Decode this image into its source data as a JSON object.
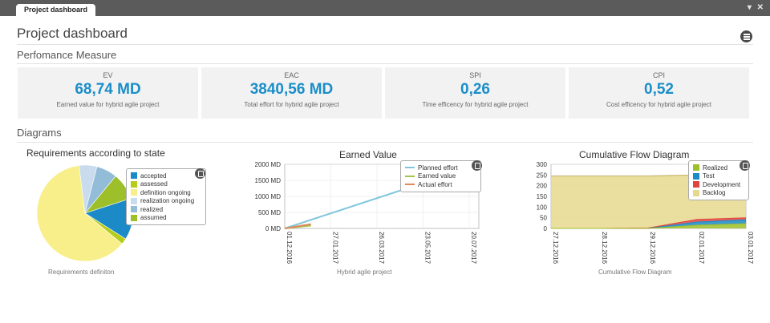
{
  "tab": {
    "label": "Project dashboard",
    "controls": "▾ ✕"
  },
  "header": {
    "title": "Project dashboard"
  },
  "performance": {
    "title": "Perfomance Measure",
    "kpis": [
      {
        "label": "EV",
        "value": "68,74 MD",
        "desc": "Earned value for hybrid agile project"
      },
      {
        "label": "EAC",
        "value": "3840,56 MD",
        "desc": "Total effort for hybrid agile project"
      },
      {
        "label": "SPI",
        "value": "0,26",
        "desc": "Time efficency for hybrid agile project"
      },
      {
        "label": "CPI",
        "value": "0,52",
        "desc": "Cost efficency for hybrid agile project"
      }
    ]
  },
  "diagrams": {
    "title": "Diagrams"
  },
  "colors": {
    "accent": "#1a8ec8",
    "kpi_bg": "#f2f2f2"
  },
  "chart_data": [
    {
      "type": "pie",
      "title": "Requirements according to state",
      "footer": "Requirements definiton",
      "slices": [
        {
          "name": "accepted",
          "value": 14,
          "color": "#1b8ac6"
        },
        {
          "name": "assessed",
          "value": 2,
          "color": "#b5cc18"
        },
        {
          "name": "definition ongoing",
          "value": 62,
          "color": "#f8ef8a"
        },
        {
          "name": "realization ongoing",
          "value": 6,
          "color": "#c8dced"
        },
        {
          "name": "realized",
          "value": 7,
          "color": "#93bcd9"
        },
        {
          "name": "assumed",
          "value": 9,
          "color": "#9dbf2a"
        }
      ]
    },
    {
      "type": "line",
      "title": "Earned Value",
      "footer": "Hybrid agile project",
      "ylim": [
        0,
        2000
      ],
      "yticks": [
        "0 MD",
        "500 MD",
        "1000 MD",
        "1500 MD",
        "2000 MD"
      ],
      "xticks": [
        "01.12.2016",
        "27.01.2017",
        "26.03.2017",
        "23.05.2017",
        "20.07.2017"
      ],
      "x_span_days": 252,
      "series": [
        {
          "name": "Planned effort",
          "color": "#7fc6dd",
          "points": [
            [
              0,
              0
            ],
            [
              165,
              1300
            ]
          ]
        },
        {
          "name": "Earned value",
          "color": "#a5c24a",
          "points": [
            [
              0,
              0
            ],
            [
              34,
              90
            ]
          ]
        },
        {
          "name": "Actual effort",
          "color": "#e08a5e",
          "points": [
            [
              0,
              0
            ],
            [
              34,
              135
            ]
          ]
        }
      ]
    },
    {
      "type": "area",
      "title": "Cumulative Flow Diagram",
      "footer": "Cumulative Flow Diagram",
      "ylim": [
        0,
        300
      ],
      "yticks": [
        "0",
        "50",
        "100",
        "150",
        "200",
        "250",
        "300"
      ],
      "xticks": [
        "27.12.2016",
        "28.12.2016",
        "29.12.2016",
        "02.01.2017",
        "03.01.2017"
      ],
      "series": [
        {
          "name": "Realized",
          "color": "#9dbf2a",
          "values": [
            0,
            0,
            0,
            15,
            22
          ]
        },
        {
          "name": "Test",
          "color": "#1b8ac6",
          "values": [
            0,
            0,
            0,
            15,
            18
          ]
        },
        {
          "name": "Development",
          "color": "#e0443c",
          "values": [
            0,
            0,
            2,
            12,
            10
          ]
        },
        {
          "name": "Backlog",
          "color": "#e6d98e",
          "values": [
            245,
            245,
            243,
            208,
            225
          ]
        }
      ]
    }
  ]
}
